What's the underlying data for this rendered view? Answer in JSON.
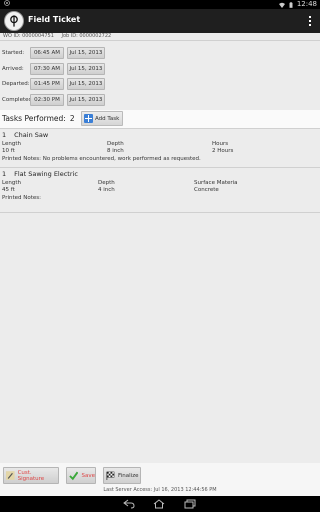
{
  "status_bar": {
    "time": "12:48"
  },
  "app": {
    "title": "Field Ticket"
  },
  "ids": {
    "wo": "WO ID: 0000004751",
    "job": "Job ID: 0000002722"
  },
  "times": [
    {
      "label": "Started:",
      "time": "06:45 AM",
      "date": "Jul 15, 2013"
    },
    {
      "label": "Arrived:",
      "time": "07:30 AM",
      "date": "Jul 15, 2013"
    },
    {
      "label": "Departed:",
      "time": "01:45 PM",
      "date": "Jul 15, 2013"
    },
    {
      "label": "Completed:",
      "time": "02:30 PM",
      "date": "Jul 15, 2013"
    }
  ],
  "tasks": {
    "title": "Tasks Performed:",
    "count": "2",
    "add_label": "Add Task",
    "items": [
      {
        "num": "1",
        "name": "Chain Saw",
        "fields": [
          {
            "label": "Length",
            "value": "10 ft"
          },
          {
            "label": "Depth",
            "value": "8 inch"
          },
          {
            "label": "Hours",
            "value": "2 Hours"
          }
        ],
        "notes": "Printed Notes: No problems encountered, work performed as requested."
      },
      {
        "num": "1",
        "name": "Flat Sawing Electric",
        "fields": [
          {
            "label": "Length",
            "value": "45 ft"
          },
          {
            "label": "Depth",
            "value": "4 inch"
          },
          {
            "label": "Surface Materia",
            "value": "Concrete"
          }
        ],
        "notes": "Printed Notes:"
      }
    ]
  },
  "footer": {
    "signature_label": "Cust. Signature",
    "save_label": "Save",
    "finalize_label": "Finalize",
    "server_access": "Last Server Access: Jul 16, 2013 12:44:56 PM"
  },
  "icons": {
    "save": "checkmark-icon",
    "signature": "pen-icon",
    "finalize": "checkered-flag-icon"
  },
  "colors": {
    "accent": "#3b7fd6",
    "warning_text": "#dd4444",
    "check_green": "#3aa83a"
  }
}
